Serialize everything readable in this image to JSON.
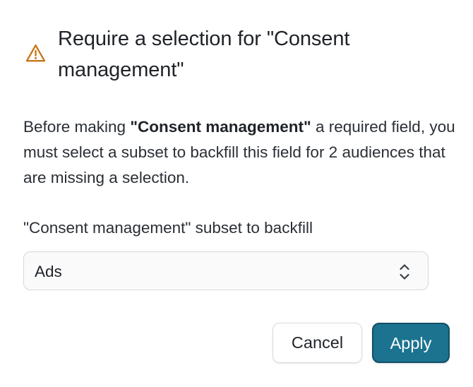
{
  "dialog": {
    "title": "Require a selection for \"Consent management\"",
    "warning_icon": "warning-triangle-icon",
    "description_prefix": "Before making ",
    "description_field": "\"Consent management\"",
    "description_suffix": " a required field, you must select a subset to backfill this field for 2 audiences that are missing a selection.",
    "field_label": "\"Consent management\" subset to backfill",
    "select": {
      "value": "Ads",
      "icon": "chevron-up-down-icon"
    },
    "buttons": {
      "cancel_label": "Cancel",
      "apply_label": "Apply"
    }
  },
  "colors": {
    "warning": "#c8771a",
    "primary": "#1b7390",
    "primary_border": "#124f66"
  }
}
